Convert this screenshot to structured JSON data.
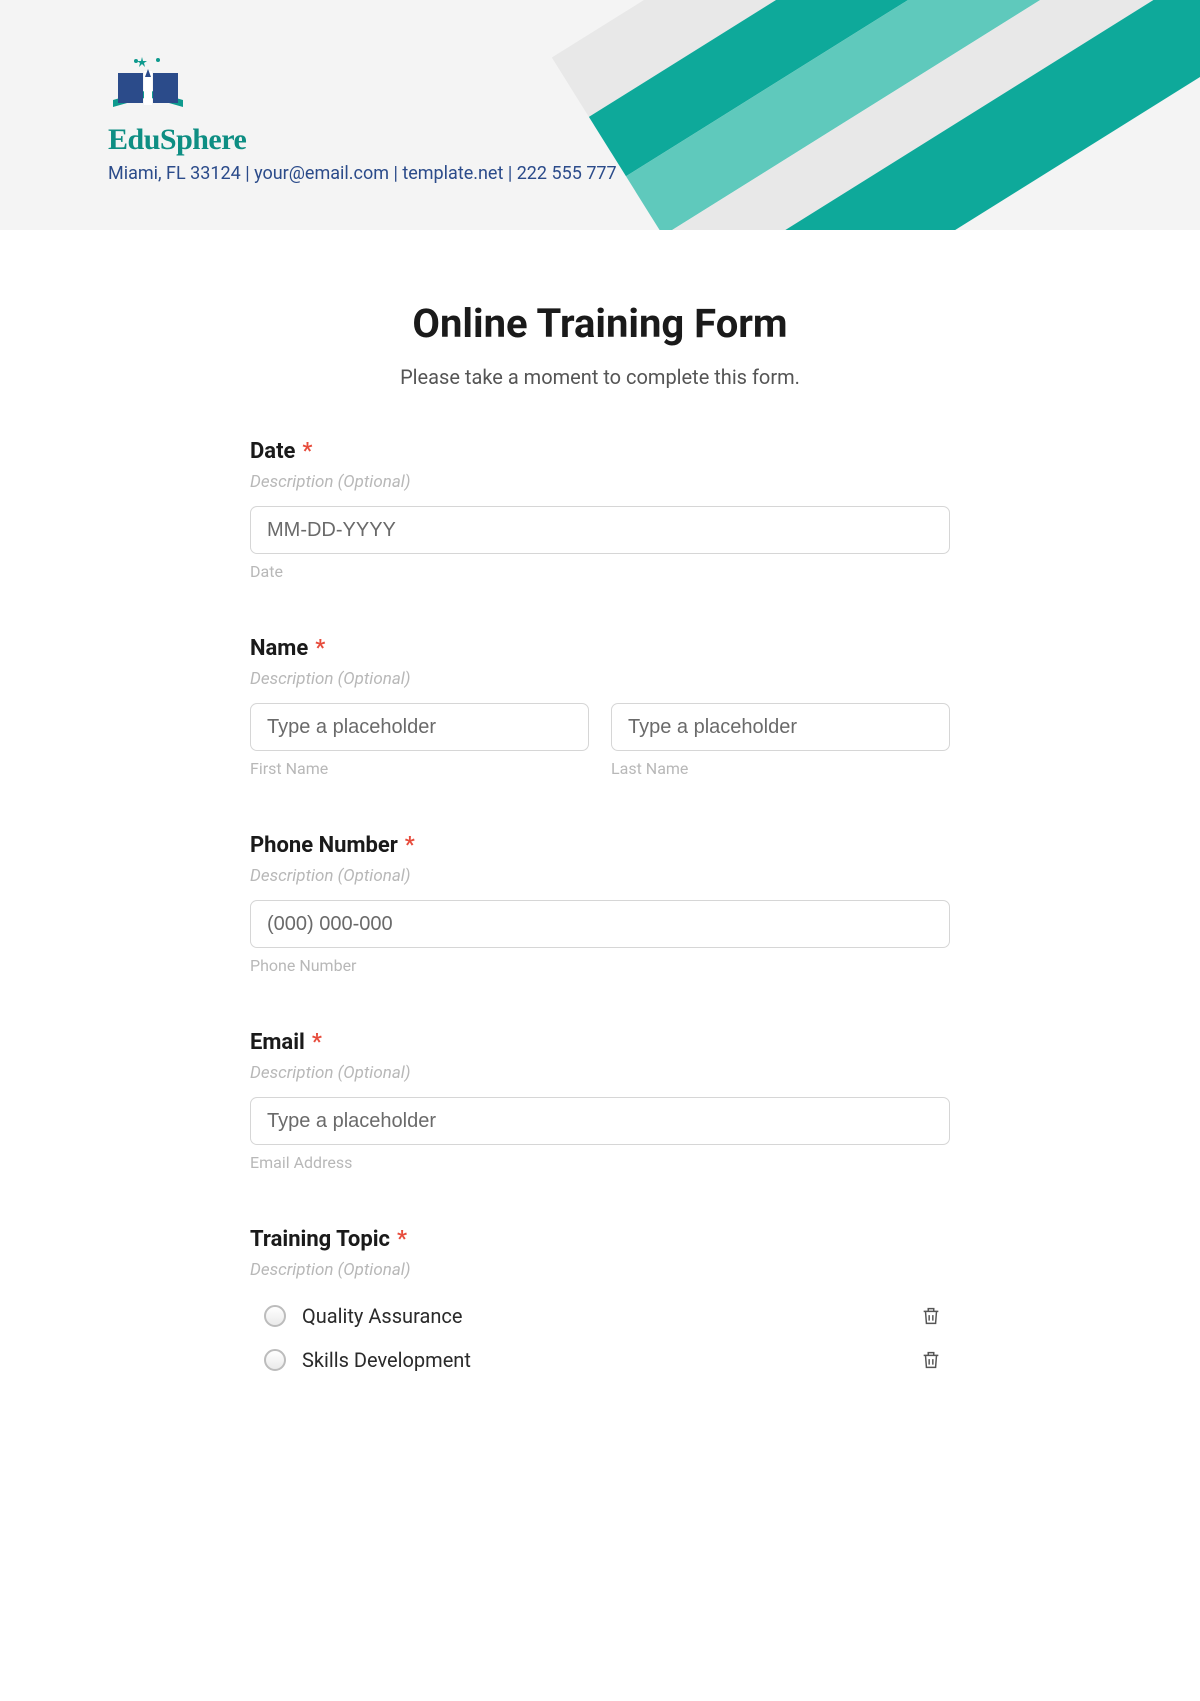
{
  "brand": {
    "name": "EduSphere",
    "sub": "Miami, FL 33124 | your@email.com | template.net | 222 555 777"
  },
  "form": {
    "title": "Online Training Form",
    "sub": "Please take a moment to complete this form.",
    "desc_placeholder": "Description (Optional)",
    "required_mark": "*"
  },
  "fields": {
    "date": {
      "label": "Date",
      "placeholder": "MM-DD-YYYY",
      "sub": "Date"
    },
    "name": {
      "label": "Name",
      "first_placeholder": "Type a placeholder",
      "last_placeholder": "Type a placeholder",
      "first_sub": "First Name",
      "last_sub": "Last Name"
    },
    "phone": {
      "label": "Phone Number",
      "placeholder": "(000) 000-000",
      "sub": "Phone Number"
    },
    "email": {
      "label": "Email",
      "placeholder": "Type a placeholder",
      "sub": "Email Address"
    },
    "topic": {
      "label": "Training Topic",
      "options": [
        "Quality Assurance",
        "Skills Development"
      ]
    }
  }
}
